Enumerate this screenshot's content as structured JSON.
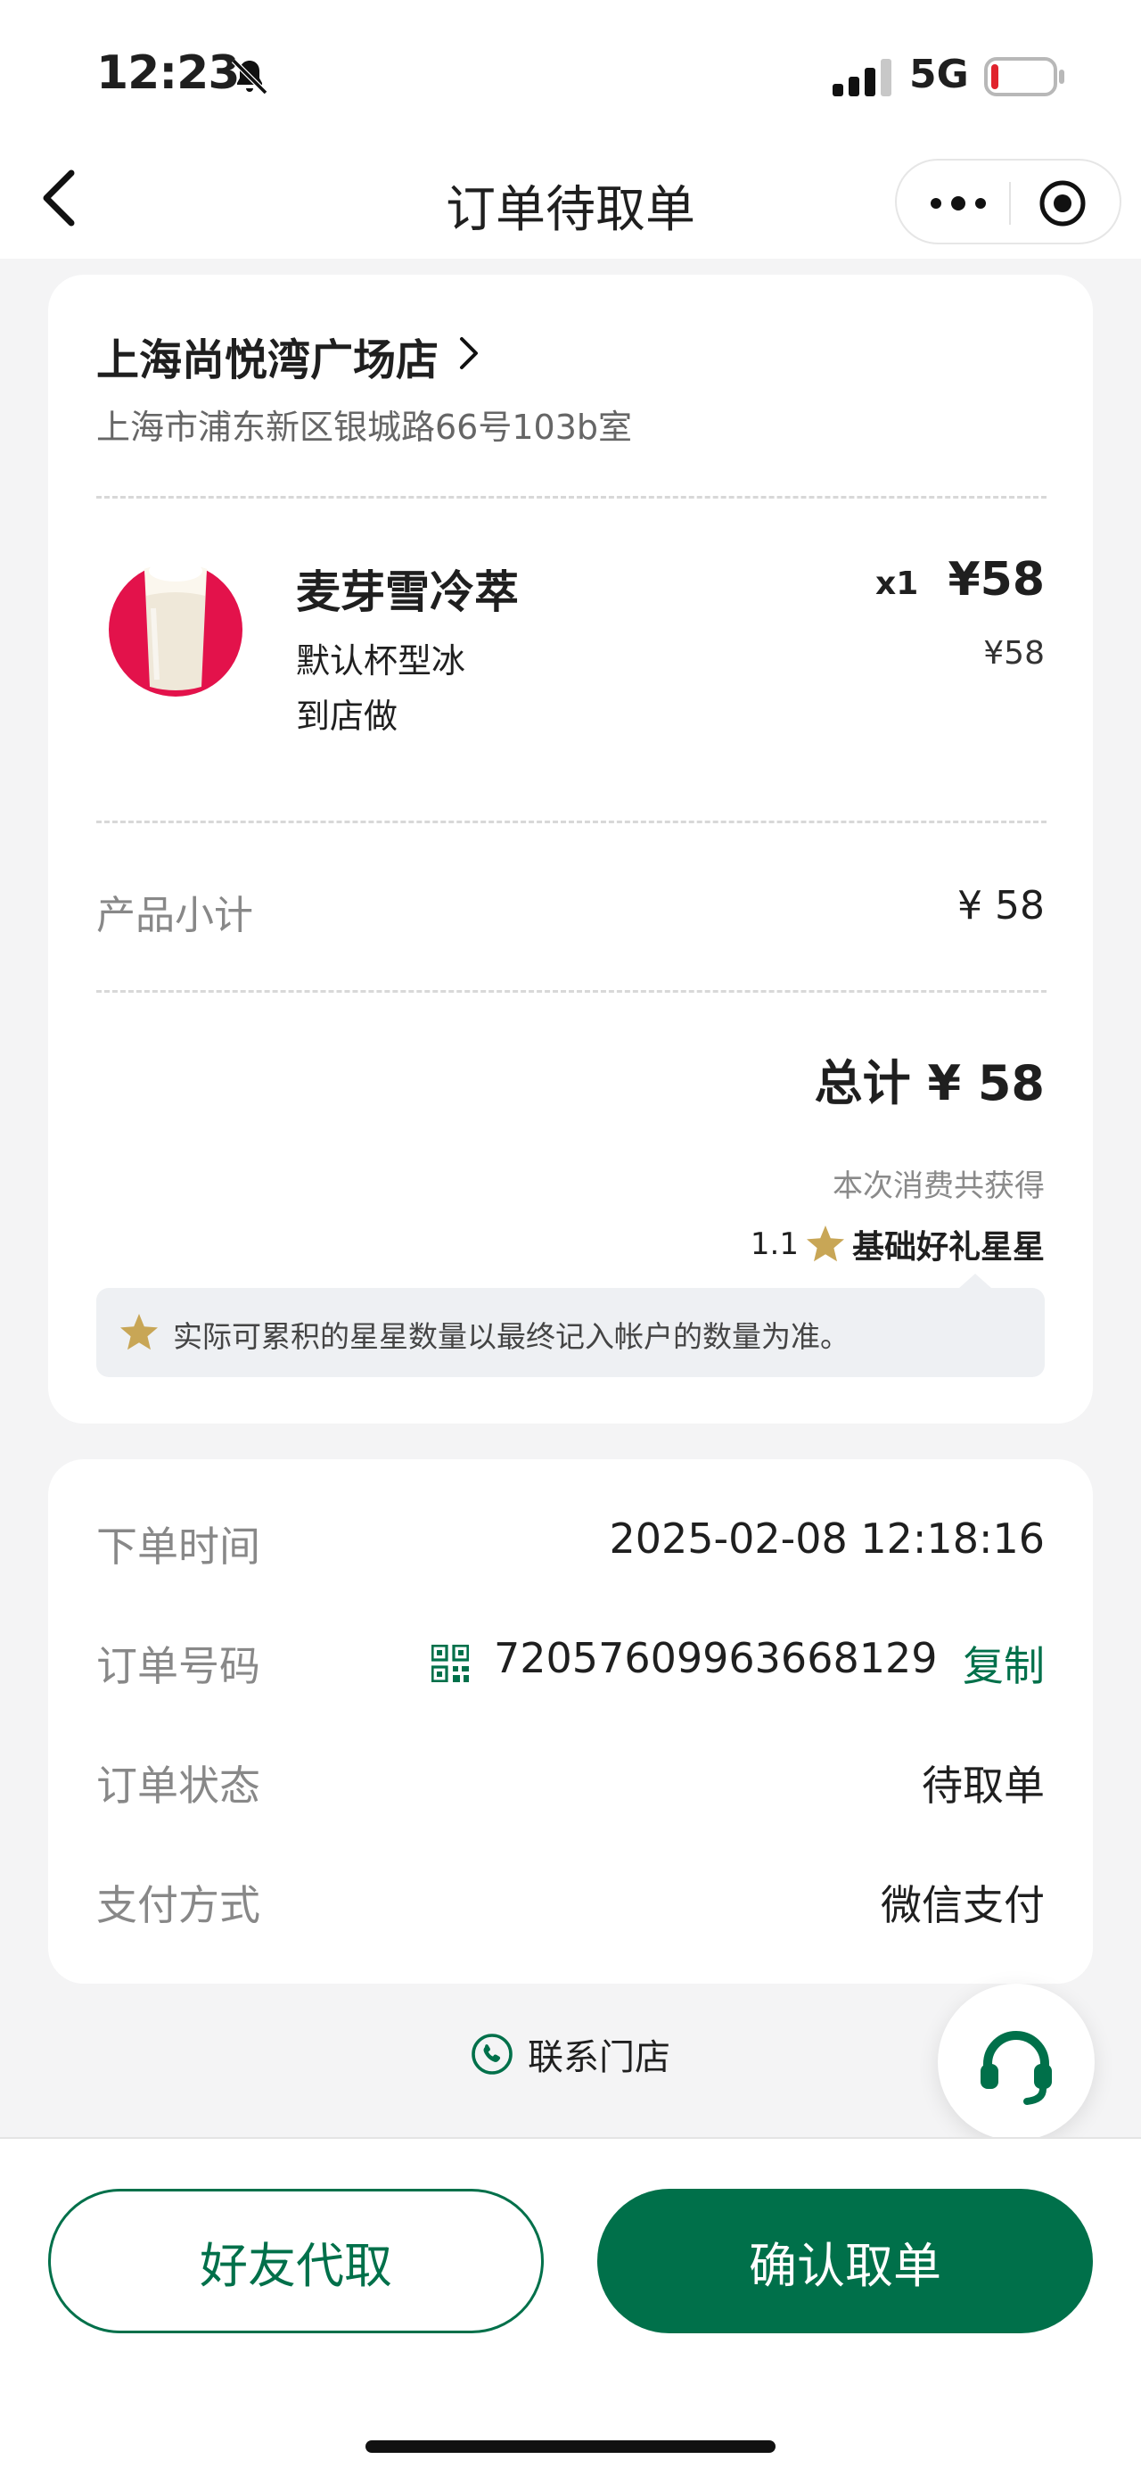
{
  "status_bar": {
    "time": "12:23",
    "network": "5G",
    "icons": [
      "bell-muted-icon",
      "signal-icon",
      "battery-icon"
    ]
  },
  "nav": {
    "title": "订单待取单",
    "icons": [
      "back-icon",
      "more-dots-icon",
      "target-icon"
    ]
  },
  "store": {
    "name": "上海尚悦湾广场店",
    "address": "上海市浦东新区银城路66号103b室"
  },
  "product": {
    "name": "麦芽雪冷萃",
    "qty": "x1",
    "price": "¥58",
    "spec": "默认杯型冰",
    "unit_price": "¥58",
    "mode": "到店做"
  },
  "summary": {
    "subtotal_label": "产品小计",
    "subtotal_value": "¥ 58",
    "total": "总计 ¥ 58",
    "earn_label": "本次消费共获得",
    "earn_amount": "1.1",
    "earn_text": "基础好礼星星",
    "note": "实际可累积的星星数量以最终记入帐户的数量为准。"
  },
  "order_info": {
    "time_label": "下单时间",
    "time_value": "2025-02-08 12:18:16",
    "number_label": "订单号码",
    "number_value": "72057609963668129",
    "copy_label": "复制",
    "status_label": "订单状态",
    "status_value": "待取单",
    "payment_label": "支付方式",
    "payment_value": "微信支付"
  },
  "contact_label": "联系门店",
  "actions": {
    "friend_pickup": "好友代取",
    "confirm_pickup": "确认取单"
  },
  "colors": {
    "brand_green": "#00704a",
    "star_gold": "#c8a656"
  }
}
